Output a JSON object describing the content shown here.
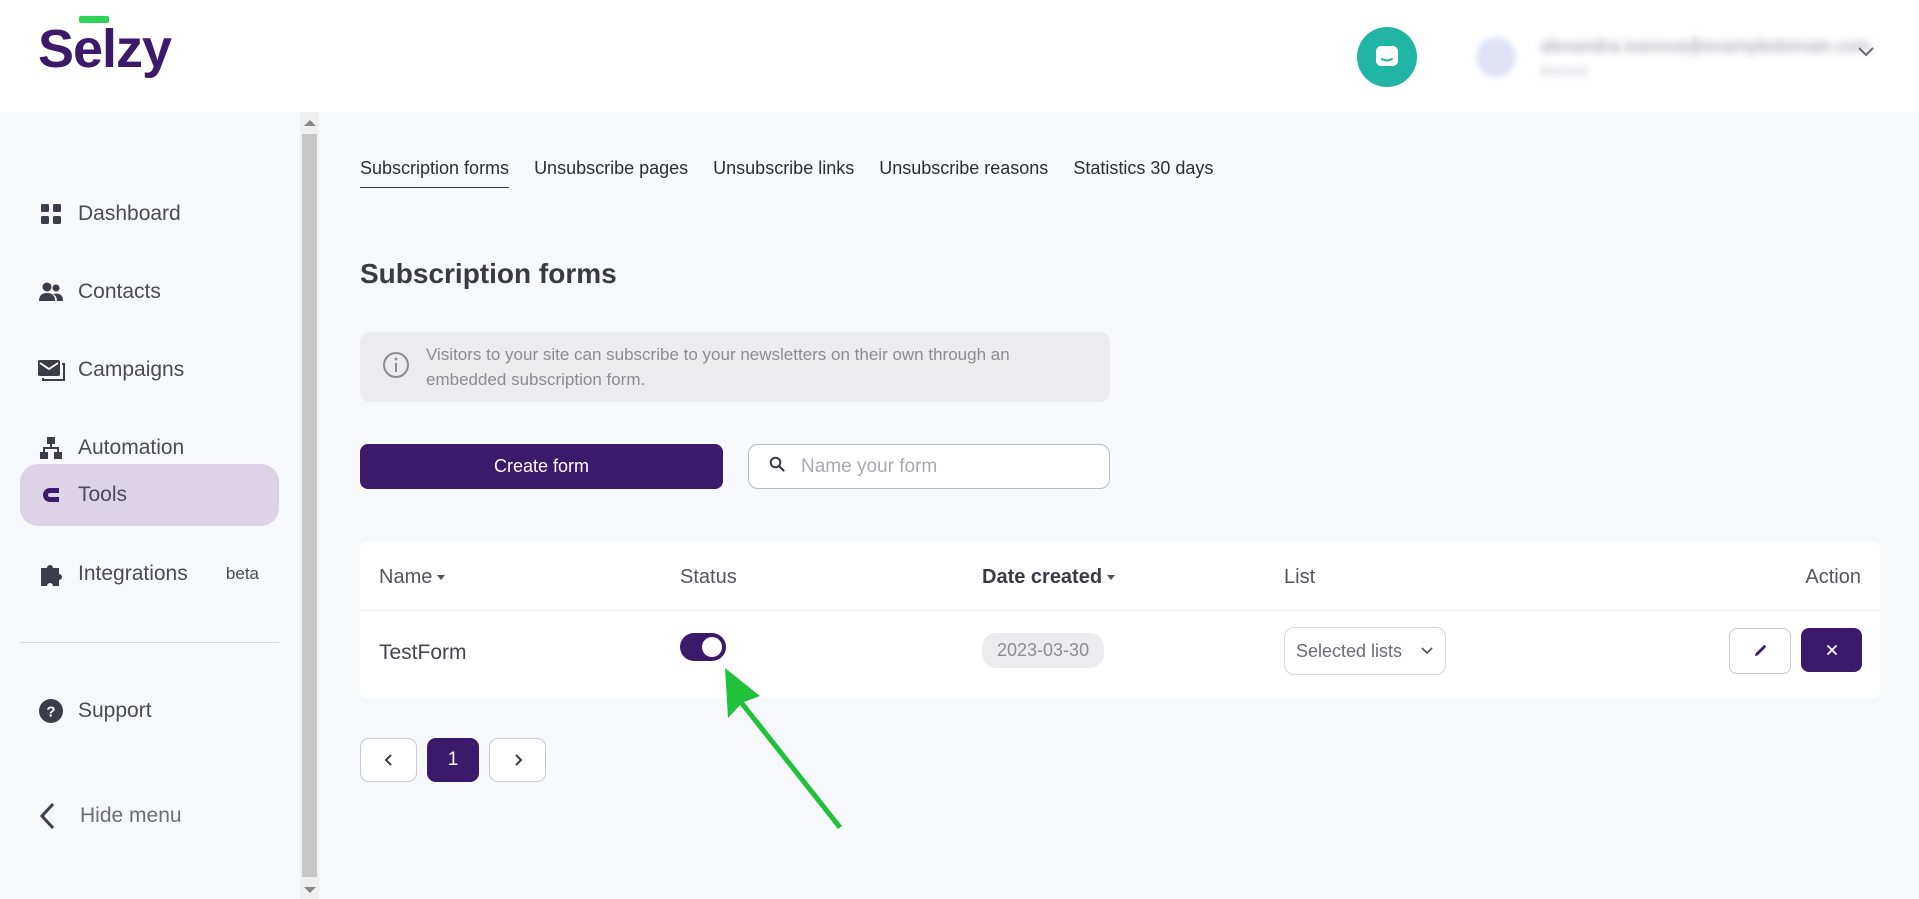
{
  "header": {
    "logo_text": "Selzy",
    "account_email": "alexandra.ivanova@exampledomain.com",
    "account_sub": "Account"
  },
  "sidebar": {
    "items": [
      {
        "label": "Dashboard",
        "icon": "grid-icon"
      },
      {
        "label": "Contacts",
        "icon": "people-icon"
      },
      {
        "label": "Campaigns",
        "icon": "mail-icon"
      },
      {
        "label": "Automation",
        "icon": "hierarchy-icon"
      },
      {
        "label": "Tools",
        "icon": "magnet-icon",
        "active": true
      },
      {
        "label": "Integrations",
        "icon": "puzzle-icon",
        "badge": "beta"
      }
    ],
    "support_label": "Support",
    "hide_menu_label": "Hide menu"
  },
  "tabs": [
    {
      "label": "Subscription forms",
      "active": true
    },
    {
      "label": "Unsubscribe pages"
    },
    {
      "label": "Unsubscribe links"
    },
    {
      "label": "Unsubscribe reasons"
    },
    {
      "label": "Statistics 30 days"
    }
  ],
  "main": {
    "title": "Subscription forms",
    "info_text": "Visitors to your site can subscribe to your newsletters on their own through an embedded subscription form.",
    "create_button": "Create form",
    "search_placeholder": "Name your form"
  },
  "table": {
    "columns": [
      "Name",
      "Status",
      "Date created",
      "List",
      "Action"
    ],
    "rows": [
      {
        "name": "TestForm",
        "status_on": true,
        "date": "2023-03-30",
        "list": "Selected lists"
      }
    ]
  },
  "pagination": {
    "current": "1"
  },
  "colors": {
    "brand": "#3b1a6b",
    "accent": "#2fd35a",
    "chat": "#20b5a4",
    "annotation_arrow": "#1fc23a"
  }
}
